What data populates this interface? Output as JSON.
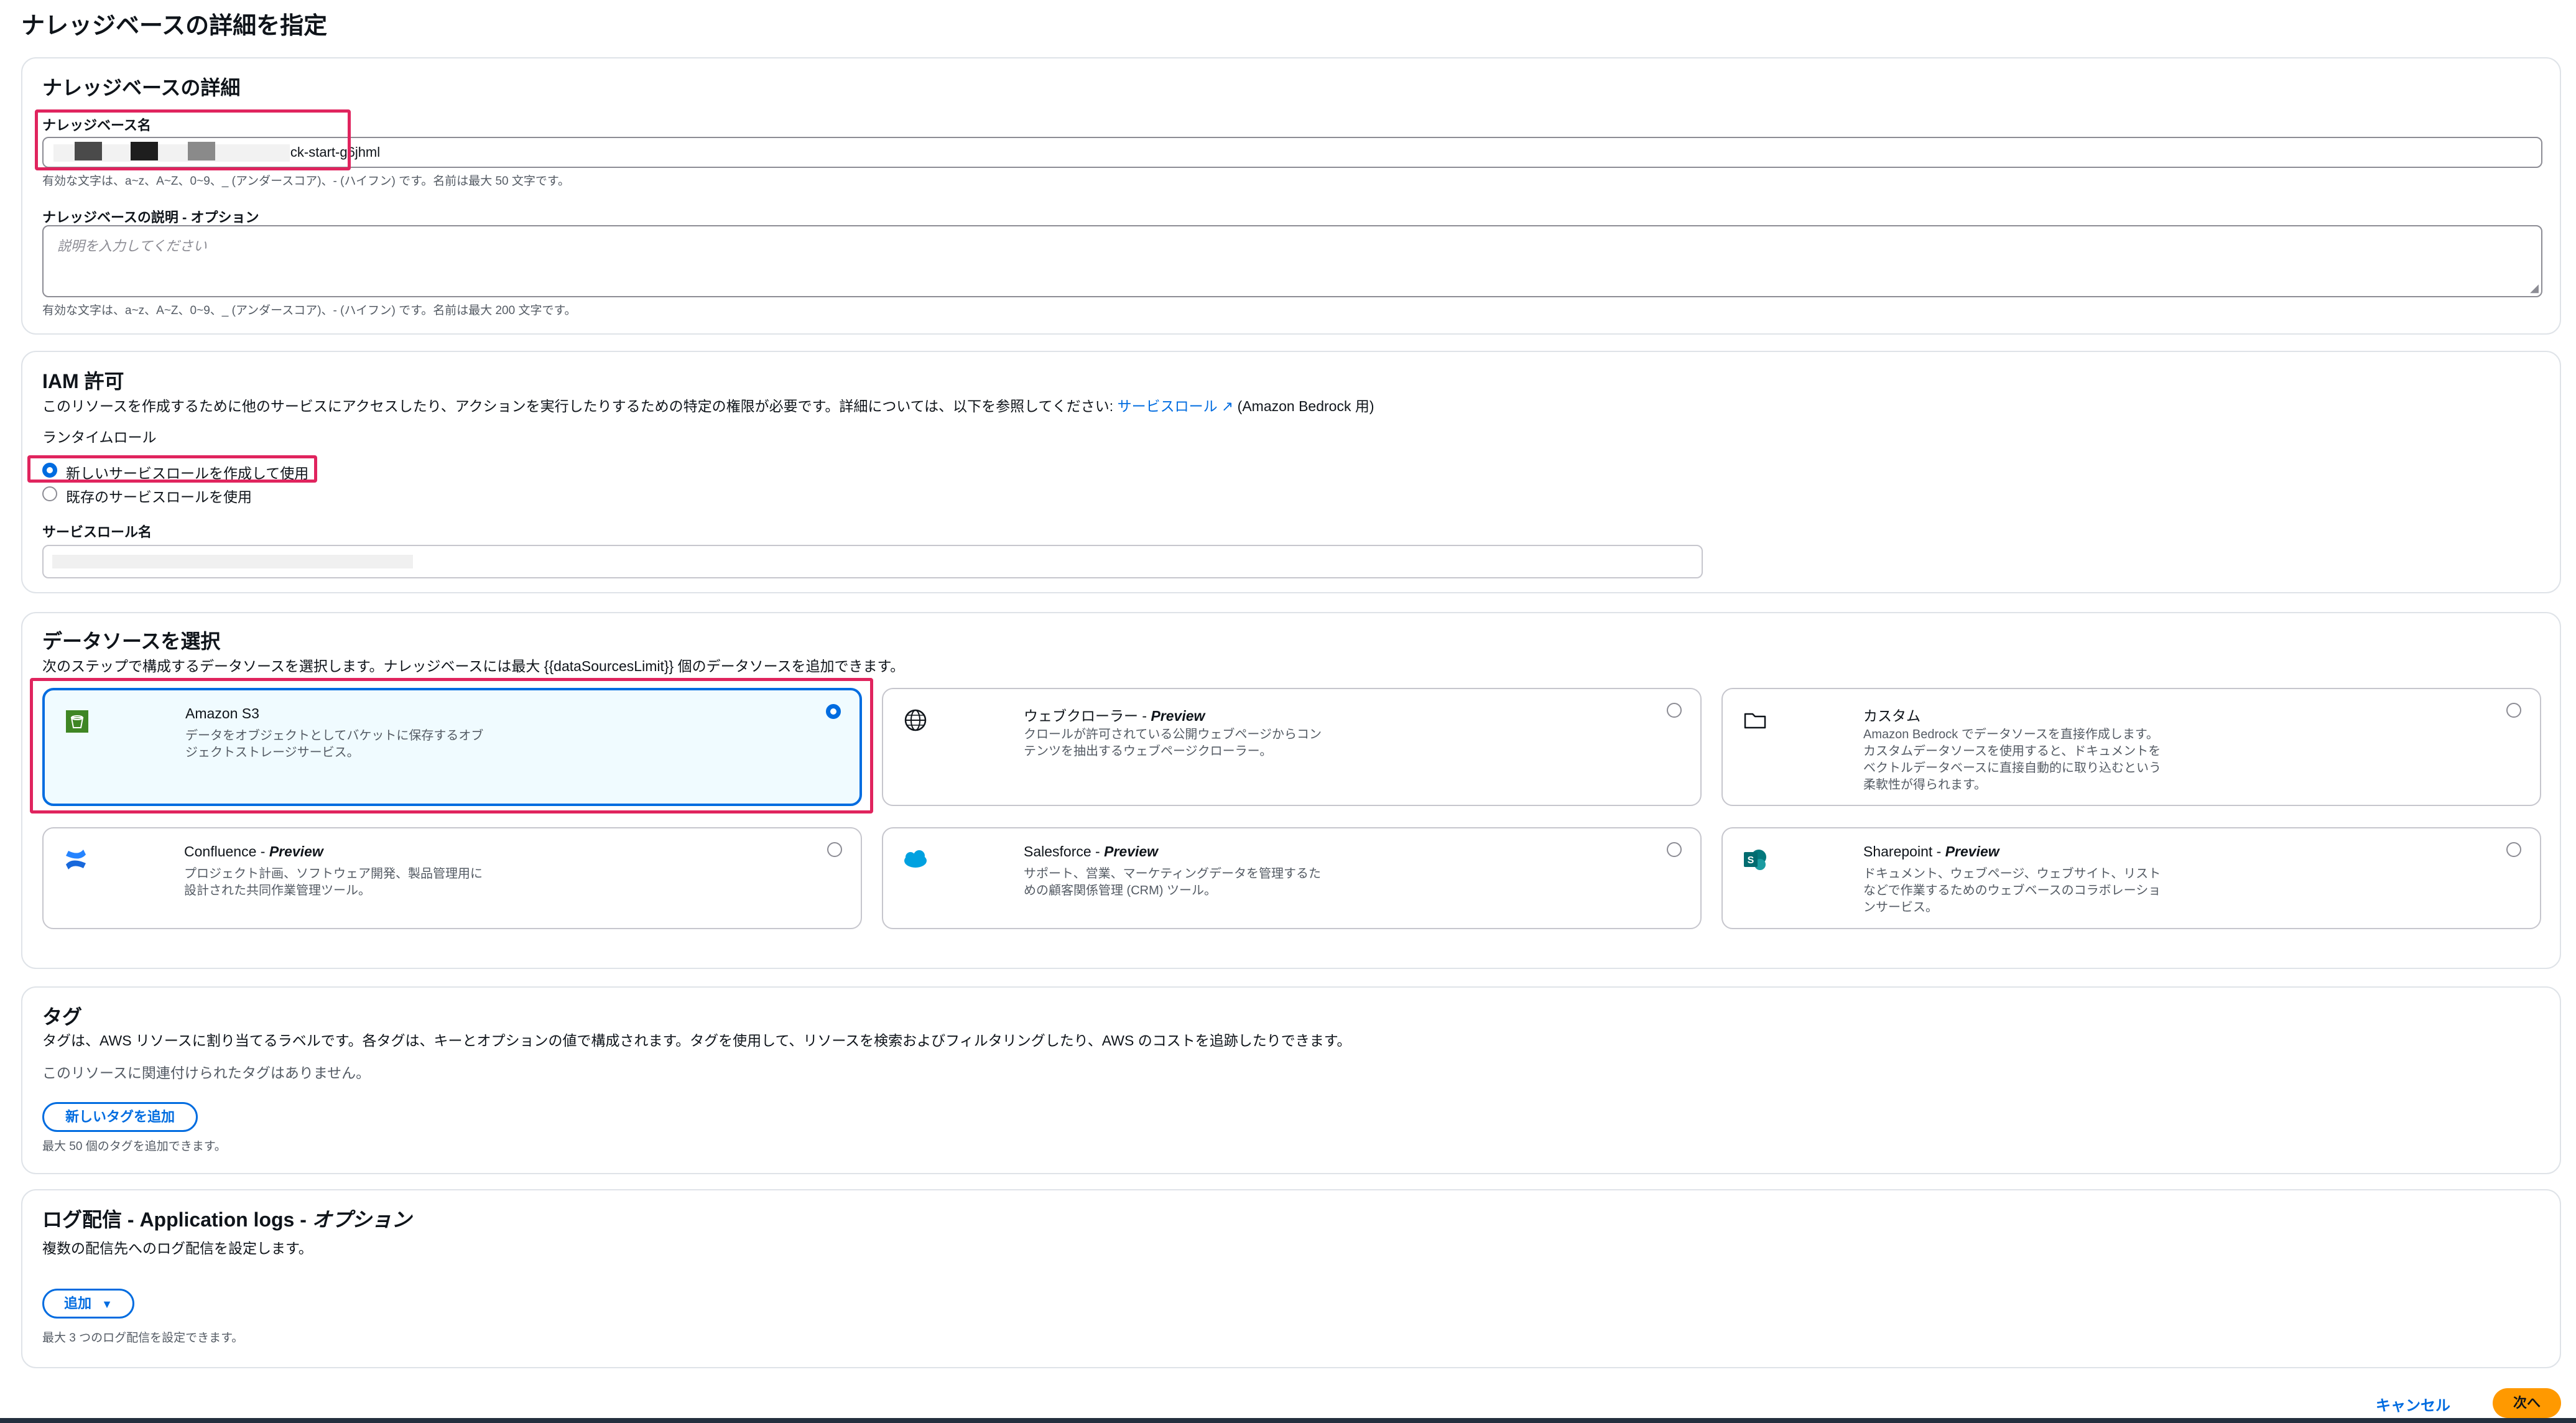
{
  "page": {
    "title": "ナレッジベースの詳細を指定"
  },
  "kb_details": {
    "heading": "ナレッジベースの詳細",
    "name_label": "ナレッジベース名",
    "name_value": "knowledge-base-quick-start-g6jhml",
    "name_hint": "有効な文字は、a~z、A~Z、0~9、_ (アンダースコア)、- (ハイフン) です。名前は最大 50 文字です。",
    "desc_label": "ナレッジベースの説明 - オプション",
    "desc_placeholder": "説明を入力してください",
    "desc_hint": "有効な文字は、a~z、A~Z、0~9、_ (アンダースコア)、- (ハイフン) です。名前は最大 200 文字です。"
  },
  "iam": {
    "heading": "IAM 許可",
    "description": "このリソースを作成するために他のサービスにアクセスしたり、アクションを実行したりするための特定の権限が必要です。詳細については、以下を参照してください:",
    "link": "サービスロール",
    "link_suffix": "(Amazon Bedrock 用)",
    "runtime_role_label": "ランタイムロール",
    "option_new": "新しいサービスロールを作成して使用",
    "option_existing": "既存のサービスロールを使用",
    "service_role_label": "サービスロール名"
  },
  "datasource": {
    "heading": "データソースを選択",
    "description": "次のステップで構成するデータソースを選択します。ナレッジベースには最大 {{dataSourcesLimit}} 個のデータソースを追加できます。",
    "cards": [
      {
        "title": "Amazon S3",
        "preview": "",
        "desc": "データをオブジェクトとしてバケットに保存するオブジェクトストレージサービス。",
        "icon": "amazon-s3-icon",
        "selected": true
      },
      {
        "title": "ウェブクローラー - ",
        "preview": "Preview",
        "desc": "クロールが許可されている公開ウェブページからコンテンツを抽出するウェブページクローラー。",
        "icon": "globe-icon",
        "selected": false
      },
      {
        "title": "カスタム",
        "preview": "",
        "desc": "Amazon Bedrock でデータソースを直接作成します。カスタムデータソースを使用すると、ドキュメントをベクトルデータベースに直接自動的に取り込むという柔軟性が得られます。",
        "icon": "folder-icon",
        "selected": false
      },
      {
        "title": "Confluence - ",
        "preview": "Preview",
        "desc": "プロジェクト計画、ソフトウェア開発、製品管理用に設計された共同作業管理ツール。",
        "icon": "confluence-icon",
        "selected": false
      },
      {
        "title": "Salesforce - ",
        "preview": "Preview",
        "desc": "サポート、営業、マーケティングデータを管理するための顧客関係管理 (CRM) ツール。",
        "icon": "salesforce-icon",
        "selected": false
      },
      {
        "title": "Sharepoint - ",
        "preview": "Preview",
        "desc": "ドキュメント、ウェブページ、ウェブサイト、リストなどで作業するためのウェブベースのコラボレーションサービス。",
        "icon": "sharepoint-icon",
        "selected": false
      }
    ]
  },
  "tags": {
    "heading": "タグ",
    "description": "タグは、AWS リソースに割り当てるラベルです。各タグは、キーとオプションの値で構成されます。タグを使用して、リソースを検索およびフィルタリングしたり、AWS のコストを追跡したりできます。",
    "empty": "このリソースに関連付けられたタグはありません。",
    "add_button": "新しいタグを追加",
    "limit_hint": "最大 50 個のタグを追加できます。"
  },
  "logs": {
    "heading_main": "ログ配信 - Application logs - ",
    "heading_italic": "オプション",
    "description": "複数の配信先へのログ配信を設定します。",
    "add_button": "追加",
    "limit_hint": "最大 3 つのログ配信を設定できます。"
  },
  "footer": {
    "cancel": "キャンセル",
    "next": "次へ"
  },
  "colors": {
    "accent": "#006ce0",
    "primary_button": "#ff9900",
    "highlight": "#e0245e"
  }
}
